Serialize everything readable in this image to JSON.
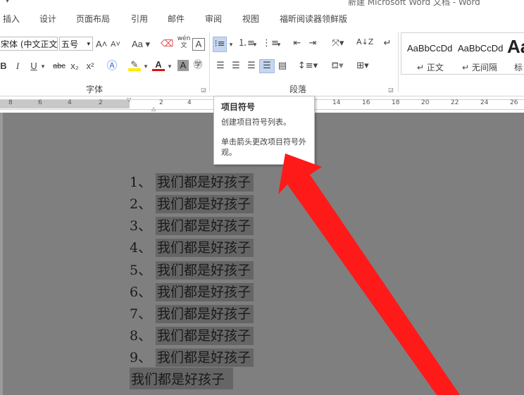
{
  "window": {
    "title": "新建 Microsoft Word 文档 - Word",
    "quick_access": "▾"
  },
  "tabs": [
    "插入",
    "设计",
    "页面布局",
    "引用",
    "邮件",
    "审阅",
    "视图",
    "福昕阅读器领鲜版"
  ],
  "font_group": {
    "font_name": "宋体 (中文正文",
    "font_size": "五号",
    "label": "字体",
    "buttons": {
      "bold": "B",
      "italic": "I",
      "underline": "U",
      "strike": "abc",
      "sub": "x₂",
      "sup": "x²",
      "change_case": "Aa",
      "grow": "A",
      "shrink": "A",
      "wen": "wén",
      "char_border": "A"
    }
  },
  "paragraph_group": {
    "label": "段落"
  },
  "styles_group": {
    "items": [
      {
        "sample": "AaBbCcDd",
        "name": "正文"
      },
      {
        "sample": "AaBbCcDd",
        "name": "无间隔"
      },
      {
        "sample": "Aa",
        "name": "标"
      }
    ]
  },
  "ruler": {
    "numbers": [
      "8",
      "6",
      "4",
      "2",
      "2",
      "4",
      "14",
      "16",
      "18",
      "20",
      "22",
      "24",
      "26"
    ]
  },
  "tooltip": {
    "title": "项目符号",
    "line1": "创建项目符号列表。",
    "line2": "单击箭头更改项目符号外观。"
  },
  "document": {
    "list_items": [
      {
        "num": "1、",
        "text": "我们都是好孩子"
      },
      {
        "num": "2、",
        "text": "我们都是好孩子"
      },
      {
        "num": "3、",
        "text": "我们都是好孩子"
      },
      {
        "num": "4、",
        "text": "我们都是好孩子"
      },
      {
        "num": "5、",
        "text": "我们都是好孩子"
      },
      {
        "num": "6、",
        "text": "我们都是好孩子"
      },
      {
        "num": "7、",
        "text": "我们都是好孩子"
      },
      {
        "num": "8、",
        "text": "我们都是好孩子"
      },
      {
        "num": "9、",
        "text": "我们都是好孩子"
      }
    ],
    "last_line": "我们都是好孩子"
  },
  "colors": {
    "annotation_arrow": "#ff1a1a",
    "doc_background": "#7f7f7f",
    "selection": "#656565"
  }
}
